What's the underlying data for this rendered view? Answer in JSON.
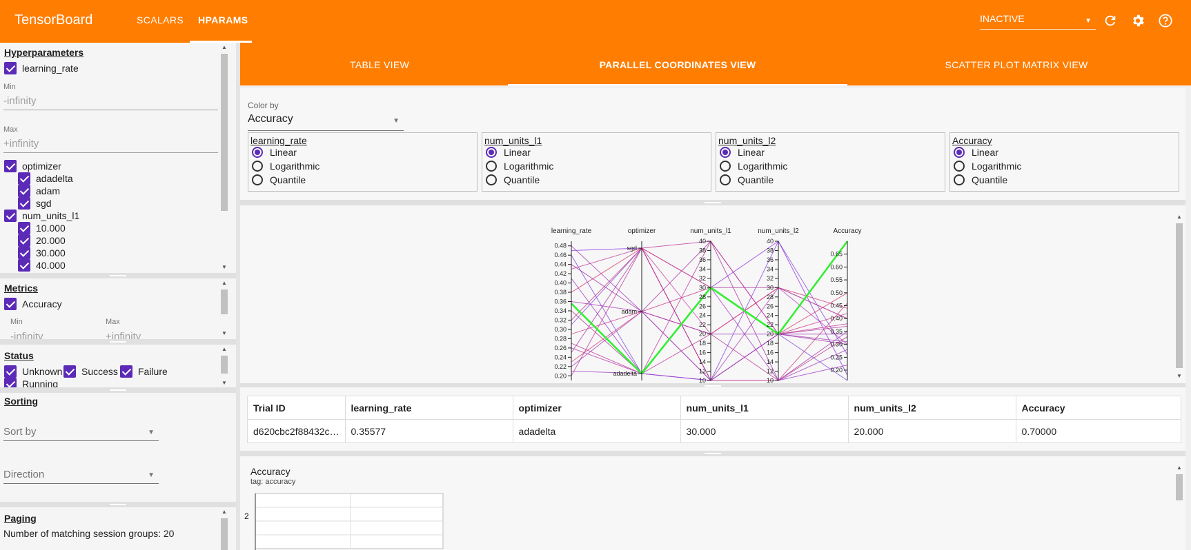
{
  "app": {
    "title": "TensorBoard",
    "tabs": [
      "SCALARS",
      "HPARAMS"
    ],
    "active_tab": "HPARAMS",
    "run_state": "INACTIVE",
    "accent": "#ff7d00",
    "checkbox_color": "#5b2ab7"
  },
  "icons": [
    "refresh-icon",
    "gear-icon",
    "help-icon",
    "dropdown-arrow-icon"
  ],
  "hyperparameters": {
    "heading": "Hyperparameters",
    "learning_rate": {
      "label": "learning_rate",
      "min_label": "Min",
      "min_value": "-infinity",
      "max_label": "Max",
      "max_value": "+infinity"
    },
    "optimizer": {
      "label": "optimizer",
      "values": [
        "adadelta",
        "adam",
        "sgd"
      ]
    },
    "num_units_l1": {
      "label": "num_units_l1",
      "values": [
        "10.000",
        "20.000",
        "30.000",
        "40.000"
      ]
    }
  },
  "metrics": {
    "heading": "Metrics",
    "accuracy": {
      "label": "Accuracy",
      "min_label": "Min",
      "min_value": "-infinity",
      "max_label": "Max",
      "max_value": "+infinity"
    }
  },
  "status": {
    "heading": "Status",
    "items": [
      "Unknown",
      "Success",
      "Failure",
      "Running"
    ]
  },
  "sorting": {
    "heading": "Sorting",
    "sort_by": "Sort by",
    "direction": "Direction"
  },
  "paging": {
    "heading": "Paging",
    "text": "Number of matching session groups: 20"
  },
  "views": {
    "tabs": [
      "TABLE VIEW",
      "PARALLEL COORDINATES VIEW",
      "SCATTER PLOT MATRIX VIEW"
    ],
    "active": "PARALLEL COORDINATES VIEW"
  },
  "color_by": {
    "label": "Color by",
    "value": "Accuracy"
  },
  "scale_boxes": [
    {
      "name": "learning_rate",
      "options": [
        "Linear",
        "Logarithmic",
        "Quantile"
      ],
      "selected": "Linear"
    },
    {
      "name": "num_units_l1",
      "options": [
        "Linear",
        "Logarithmic",
        "Quantile"
      ],
      "selected": "Linear"
    },
    {
      "name": "num_units_l2",
      "options": [
        "Linear",
        "Logarithmic",
        "Quantile"
      ],
      "selected": "Linear"
    },
    {
      "name": "Accuracy",
      "options": [
        "Linear",
        "Logarithmic",
        "Quantile"
      ],
      "selected": "Linear"
    }
  ],
  "chart_data": {
    "type": "parallel-coordinates",
    "axes": [
      {
        "name": "learning_rate",
        "ticks": [
          "0.48",
          "0.46",
          "0.44",
          "0.42",
          "0.40",
          "0.38",
          "0.36",
          "0.34",
          "0.32",
          "0.30",
          "0.28",
          "0.26",
          "0.24",
          "0.22",
          "0.20"
        ],
        "range": [
          0.19,
          0.49
        ]
      },
      {
        "name": "optimizer",
        "categories": [
          "sgd",
          "adam",
          "adadelta"
        ]
      },
      {
        "name": "num_units_l1",
        "ticks": [
          "40",
          "38",
          "36",
          "34",
          "32",
          "30",
          "28",
          "26",
          "24",
          "22",
          "20",
          "18",
          "16",
          "14",
          "12",
          "10"
        ],
        "range": [
          10,
          40
        ]
      },
      {
        "name": "num_units_l2",
        "ticks": [
          "40",
          "38",
          "36",
          "34",
          "32",
          "30",
          "28",
          "26",
          "24",
          "22",
          "20",
          "18",
          "16",
          "14",
          "12",
          "10"
        ],
        "range": [
          10,
          40
        ]
      },
      {
        "name": "Accuracy",
        "ticks": [
          "0.65",
          "0.60",
          "0.55",
          "0.50",
          "0.45",
          "0.40",
          "0.35",
          "0.30",
          "0.25",
          "0.20"
        ],
        "range": [
          0.16,
          0.7
        ]
      }
    ],
    "series": [
      {
        "values": [
          0.35577,
          "adadelta",
          30,
          20,
          0.7
        ],
        "color": "#33ee33",
        "highlight": true
      },
      {
        "values": [
          0.47,
          "sgd",
          30,
          40,
          0.18
        ],
        "color": "#8a2be2"
      },
      {
        "values": [
          0.46,
          "adadelta",
          10,
          20,
          0.16
        ],
        "color": "#7b3fe4"
      },
      {
        "values": [
          0.44,
          "adam",
          40,
          10,
          0.35
        ],
        "color": "#a22ca0"
      },
      {
        "values": [
          0.43,
          "sgd",
          20,
          30,
          0.4
        ],
        "color": "#c23b9a"
      },
      {
        "values": [
          0.41,
          "adadelta",
          10,
          10,
          0.22
        ],
        "color": "#9b30c6"
      },
      {
        "values": [
          0.38,
          "sgd",
          30,
          20,
          0.5
        ],
        "color": "#d6336c"
      },
      {
        "values": [
          0.36,
          "adam",
          10,
          30,
          0.3
        ],
        "color": "#a73ab8"
      },
      {
        "values": [
          0.34,
          "adadelta",
          20,
          10,
          0.33
        ],
        "color": "#b5318f"
      },
      {
        "values": [
          0.31,
          "sgd",
          10,
          40,
          0.26
        ],
        "color": "#8040d8"
      },
      {
        "values": [
          0.29,
          "adam",
          30,
          20,
          0.42
        ],
        "color": "#c9358b"
      },
      {
        "values": [
          0.27,
          "adadelta",
          40,
          20,
          0.37
        ],
        "color": "#b83399"
      },
      {
        "values": [
          0.25,
          "sgd",
          10,
          20,
          0.3
        ],
        "color": "#a837a9"
      },
      {
        "values": [
          0.23,
          "adam",
          20,
          30,
          0.44
        ],
        "color": "#cf3473"
      },
      {
        "values": [
          0.21,
          "adadelta",
          30,
          10,
          0.28
        ],
        "color": "#9d36bc"
      },
      {
        "values": [
          0.2,
          "sgd",
          40,
          20,
          0.38
        ],
        "color": "#bb329a"
      },
      {
        "values": [
          0.48,
          "adam",
          20,
          20,
          0.34
        ],
        "color": "#9f35b8"
      },
      {
        "values": [
          0.32,
          "sgd",
          10,
          10,
          0.46
        ],
        "color": "#c8347f"
      },
      {
        "values": [
          0.26,
          "adadelta",
          30,
          30,
          0.4
        ],
        "color": "#b03aa2"
      },
      {
        "values": [
          0.22,
          "adam",
          10,
          20,
          0.31
        ],
        "color": "#a23bb3"
      }
    ]
  },
  "session_table": {
    "headers": [
      "Trial ID",
      "learning_rate",
      "optimizer",
      "num_units_l1",
      "num_units_l2",
      "Accuracy"
    ],
    "rows": [
      [
        "d620cbc2f88432c…",
        "0.35577",
        "adadelta",
        "30.000",
        "20.000",
        "0.70000"
      ]
    ]
  },
  "metric_chart": {
    "title": "Accuracy",
    "tag": "tag: accuracy",
    "y_tick": "2"
  }
}
